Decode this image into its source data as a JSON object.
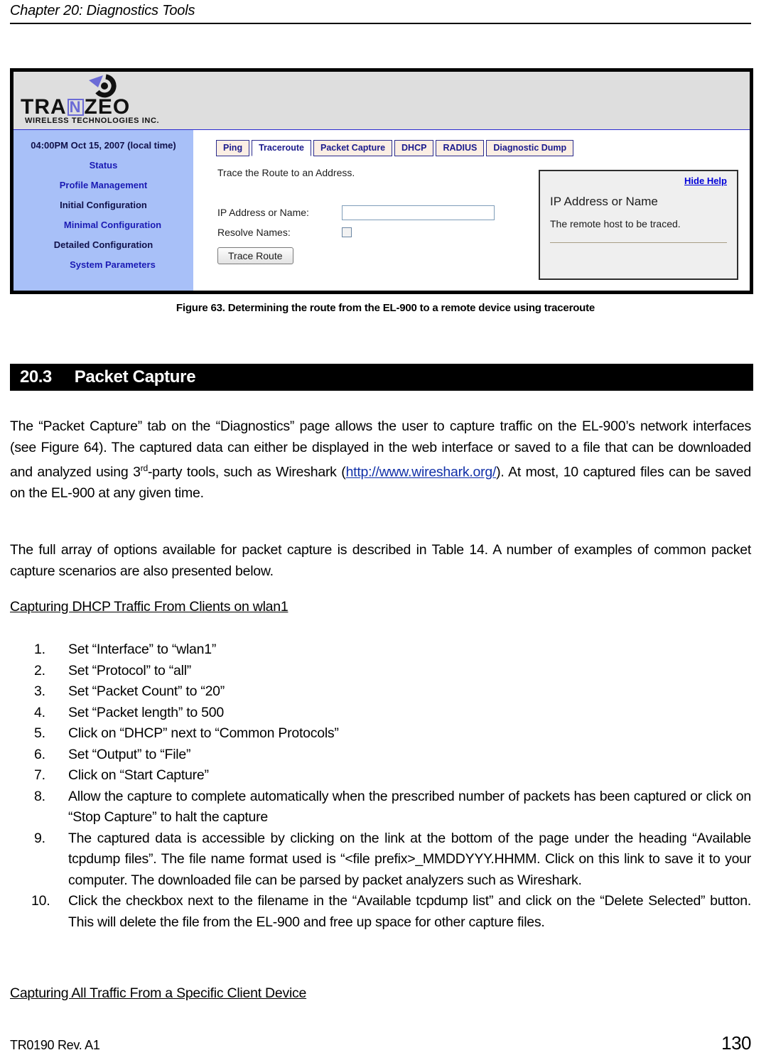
{
  "header": {
    "chapter_title": "Chapter 20: Diagnostics Tools"
  },
  "figure": {
    "caption": "Figure 63. Determining the route from the EL-900 to a remote device using traceroute",
    "ui": {
      "logo": {
        "word_part1": "TRA",
        "word_n": "N",
        "word_part2": "ZEO",
        "subtitle": "WIRELESS  TECHNOLOGIES INC."
      },
      "sidebar": {
        "clock": "04:00PM Oct 15, 2007 (local time)",
        "items": [
          {
            "label": "Status"
          },
          {
            "label": "Profile Management"
          },
          {
            "label": "Initial Configuration"
          },
          {
            "label": "Minimal Configuration"
          },
          {
            "label": "Detailed Configuration"
          },
          {
            "label": "System Parameters"
          }
        ]
      },
      "tabs": [
        {
          "label": "Ping",
          "active": false
        },
        {
          "label": "Traceroute",
          "active": true
        },
        {
          "label": "Packet Capture",
          "active": false
        },
        {
          "label": "DHCP",
          "active": false
        },
        {
          "label": "RADIUS",
          "active": false
        },
        {
          "label": "Diagnostic Dump",
          "active": false
        }
      ],
      "main": {
        "intro": "Trace the Route to an Address.",
        "field_ip_label": "IP Address or Name:",
        "field_ip_value": "",
        "field_resolve_label": "Resolve Names:",
        "resolve_checked": false,
        "button_label": "Trace Route"
      },
      "help": {
        "toggle_label": "Hide Help",
        "title": "IP Address or Name",
        "text": "The remote host to be traced."
      }
    }
  },
  "section": {
    "number": "20.3",
    "title": "Packet Capture"
  },
  "body": {
    "paragraph1_before_link": "The “Packet Capture” tab on the “Diagnostics” page allows the user to capture traffic on the EL-900’s network interfaces (see Figure 64). The captured data can either be displayed in the web interface or saved to a file that can be downloaded and analyzed using 3",
    "paragraph1_sup": "rd",
    "paragraph1_mid": "-party tools, such as Wireshark (",
    "paragraph1_link": "http://www.wireshark.org/",
    "paragraph1_after_link": "). At most, 10 captured files can be saved on the EL-900 at any given time.",
    "paragraph2": "The full array of options available for packet capture is described in Table 14. A number of examples of common packet capture scenarios are also presented below.",
    "subheading1": "Capturing DHCP Traffic From Clients on wlan1",
    "subheading2": "Capturing All Traffic From a Specific Client Device"
  },
  "steps": [
    {
      "marker": "1.",
      "text": "Set “Interface” to “wlan1”"
    },
    {
      "marker": "2.",
      "text": "Set “Protocol” to “all”"
    },
    {
      "marker": "3.",
      "text": "Set “Packet Count” to “20”"
    },
    {
      "marker": "4.",
      "text": "Set “Packet length” to 500"
    },
    {
      "marker": "5.",
      "text": "Click on “DHCP” next to “Common Protocols”"
    },
    {
      "marker": "6.",
      "text": "Set “Output” to “File”"
    },
    {
      "marker": "7.",
      "text": "Click on “Start Capture”"
    },
    {
      "marker": "8.",
      "text": "Allow the capture to complete automatically when the prescribed number of packets has been captured or click on “Stop Capture” to halt the capture"
    },
    {
      "marker": "9.",
      "text": "The captured data is accessible by clicking on the link at the bottom of the page under the heading “Available tcpdump files”. The file name format used is “<file prefix>_MMDDYYY.HHMM. Click on this link to save it to your computer. The downloaded file can be parsed by packet analyzers such as Wireshark."
    },
    {
      "marker": "10.",
      "text": "Click the checkbox next to the filename in the “Available tcpdump list” and click on the “Delete Selected” button. This will delete the file from the EL-900 and free up space for other capture files."
    }
  ],
  "footer": {
    "doc_id": "TR0190 Rev. A1",
    "page_number": "130"
  }
}
